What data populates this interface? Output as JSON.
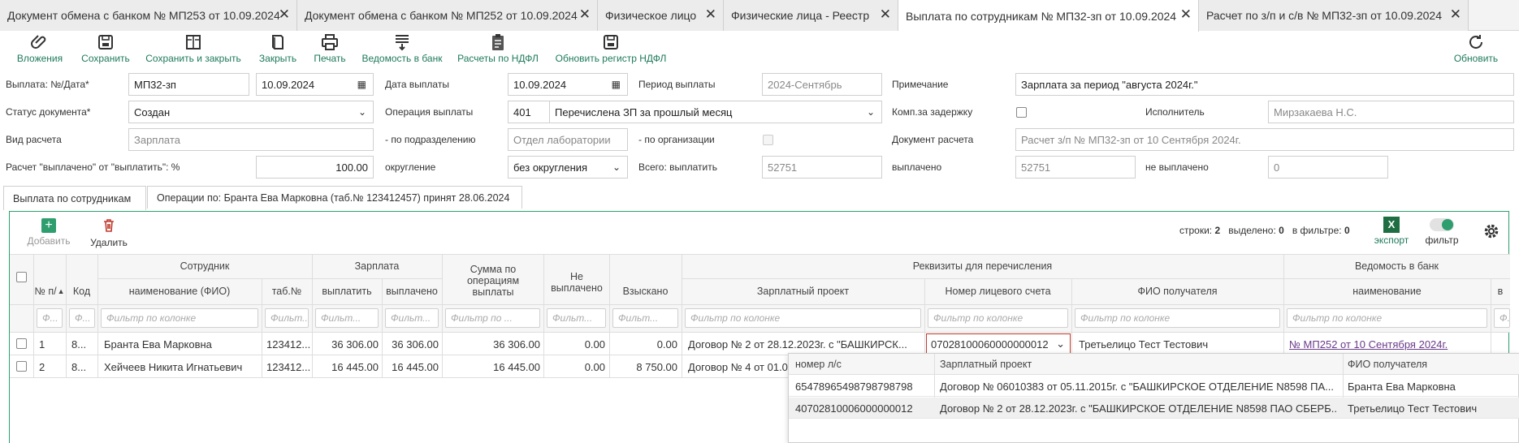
{
  "tabs": [
    {
      "label": "Документ обмена с банком № МП253 от 10.09.2024"
    },
    {
      "label": "Документ обмена с банком № МП252 от 10.09.2024"
    },
    {
      "label": "Физическое лицо"
    },
    {
      "label": "Физические лица - Реестр"
    },
    {
      "label": "Выплата по сотрудникам № МП32-зп от 10.09.2024"
    },
    {
      "label": "Расчет по з/п и с/в № МП32-зп от 10.09.2024"
    }
  ],
  "toolbar": {
    "attachments": "Вложения",
    "save": "Сохранить",
    "save_close": "Сохранить и закрыть",
    "close": "Закрыть",
    "print": "Печать",
    "bank_statement": "Ведомость в банк",
    "ndfl_calc": "Расчеты по НДФЛ",
    "update_ndfl": "Обновить регистр НДФЛ",
    "refresh": "Обновить"
  },
  "form": {
    "payment_no_date_label": "Выплата: №/Дата*",
    "payment_no": "МП32-зп",
    "payment_date": "10.09.2024",
    "pay_date_label": "Дата выплаты",
    "pay_date": "10.09.2024",
    "period_label": "Период выплаты",
    "period": "2024-Сентябрь",
    "note_label": "Примечание",
    "note": "Зарплата за период \"августа 2024г.\"",
    "status_label": "Статус документа*",
    "status": "Создан",
    "operation_label": "Операция выплаты",
    "operation_code": "401",
    "operation_name": "Перечислена ЗП за прошлый месяц",
    "comp_delay_label": "Комп.за задержку",
    "executor_label": "Исполнитель",
    "executor": "Мирзакаева Н.С.",
    "calc_type_label": "Вид расчета",
    "calc_type": "Зарплата",
    "by_department_label": "- по подразделению",
    "by_department": "Отдел лаборатории",
    "by_org_label": "- по организации",
    "calc_doc_label": "Документ расчета",
    "calc_doc": "Расчет з/п № МП32-зп от 10 Сентября 2024г.",
    "paid_pct_label": "Расчет \"выплачено\" от \"выплатить\": %",
    "paid_pct": "100.00",
    "rounding_label": "округление",
    "rounding": "без округления",
    "total_label": "Всего: выплатить",
    "total": "52751",
    "paid_label": "выплачено",
    "paid": "52751",
    "unpaid_label": "не выплачено",
    "unpaid": "0"
  },
  "subtabs": [
    {
      "label": "Выплата по сотрудникам"
    },
    {
      "label": "Операции по: Бранта Ева Марковна (таб.№ 123412457) принят 28.06.2024"
    }
  ],
  "grid_toolbar": {
    "add": "Добавить",
    "delete": "Удалить",
    "rows_label": "строки:",
    "rows": "2",
    "selected_label": "выделено:",
    "selected": "0",
    "in_filter_label": "в фильтре:",
    "in_filter": "0",
    "export": "экспорт",
    "filter": "фильтр"
  },
  "grid": {
    "group_employee": "Сотрудник",
    "group_salary": "Зарплата",
    "group_requisites": "Реквизиты для перечисления",
    "group_bank_statement": "Ведомость в банк",
    "col_no": "№ п/",
    "col_code": "Код",
    "col_name": "наименование (ФИО)",
    "col_tab": "таб.№",
    "col_to_pay": "выплатить",
    "col_paid": "выплачено",
    "col_ops_sum": "Сумма по операциям выплаты",
    "col_unpaid": "Не выплачено",
    "col_recovered": "Взыскано",
    "col_salary_project": "Зарплатный проект",
    "col_account": "Номер лицевого счета",
    "col_recipient": "ФИО получателя",
    "col_bs_name": "наименование",
    "col_extra": "в",
    "filter_short": "Ф...",
    "filter_mid": "Фильт...",
    "filter_long": "Фильтр по ...",
    "filter_full": "Фильтр по колонке",
    "rows": [
      {
        "no": "1",
        "code": "8...",
        "name": "Бранта Ева Марковна",
        "tab": "123412...",
        "to_pay": "36 306.00",
        "paid": "36 306.00",
        "ops_sum": "36 306.00",
        "unpaid": "0.00",
        "recovered": "0.00",
        "project": "Договор № 2 от 28.12.2023г. с \"БАШКИРСК...",
        "account": "07028100060000000012",
        "recipient": "Третьелицо Тест Тестович",
        "bs_name": "№ МП252 от 10 Сентября 2024г."
      },
      {
        "no": "2",
        "code": "8...",
        "name": "Хейчеев Никита Игнатьевич",
        "tab": "123412...",
        "to_pay": "16 445.00",
        "paid": "16 445.00",
        "ops_sum": "16 445.00",
        "unpaid": "0.00",
        "recovered": "8 750.00",
        "project": "Договор № 4 от 01.0",
        "account": "",
        "recipient": "",
        "bs_name": ""
      }
    ]
  },
  "dropdown": {
    "col_account": "номер л/с",
    "col_project": "Зарплатный проект",
    "col_recipient": "ФИО получателя",
    "rows": [
      {
        "account": "65478965498798798798",
        "project": "Договор № 06010383 от 05.11.2015г. с \"БАШКИРСКОЕ ОТДЕЛЕНИЕ N8598 ПА...",
        "recipient": "Бранта Ева Марковна"
      },
      {
        "account": "40702810006000000012",
        "project": "Договор № 2 от 28.12.2023г. с \"БАШКИРСКОЕ ОТДЕЛЕНИЕ N8598 ПАО СБЕРБ...",
        "recipient": "Третьелицо Тест Тестович"
      }
    ]
  },
  "colors": {
    "accent": "#1e7a5a",
    "grid_border": "#2e9e6e",
    "delete": "#c0392b",
    "link": "#6a3a8a",
    "excel": "#1e6e42",
    "active_field_border": "#c0392b"
  }
}
